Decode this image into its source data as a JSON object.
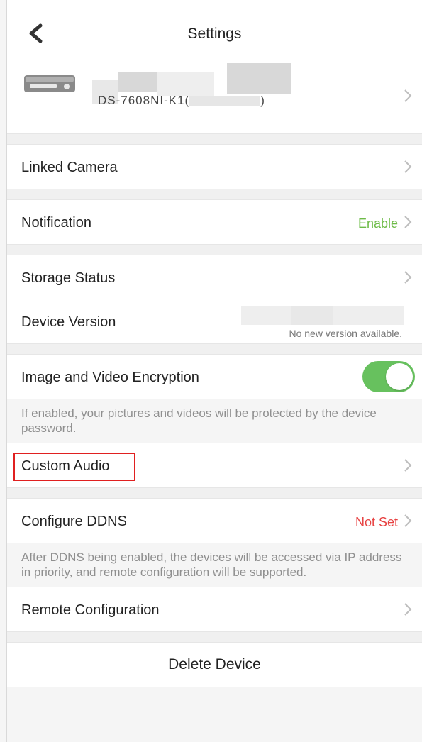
{
  "header": {
    "title": "Settings",
    "back_icon": "back-chevron-icon"
  },
  "device": {
    "name_partial": "DS-7608NI-K1(",
    "name_end": ")"
  },
  "rows": {
    "linked_camera": "Linked Camera",
    "notification": {
      "label": "Notification",
      "value": "Enable",
      "value_color": "#6dbb47"
    },
    "storage_status": "Storage Status",
    "device_version": {
      "label": "Device Version",
      "status": "No new version available."
    },
    "encryption": {
      "label": "Image and Video Encryption",
      "enabled": true,
      "hint": "If enabled, your pictures and videos will be protected by the device password."
    },
    "custom_audio": "Custom Audio",
    "ddns": {
      "label": "Configure DDNS",
      "value": "Not Set",
      "value_color": "#e74242",
      "hint": "After DDNS being enabled, the devices will be accessed via IP address in priority, and remote configuration will be supported."
    },
    "remote_config": "Remote Configuration"
  },
  "delete_button": "Delete Device",
  "colors": {
    "toggle_on": "#67c15e",
    "highlight": "#e02020"
  }
}
